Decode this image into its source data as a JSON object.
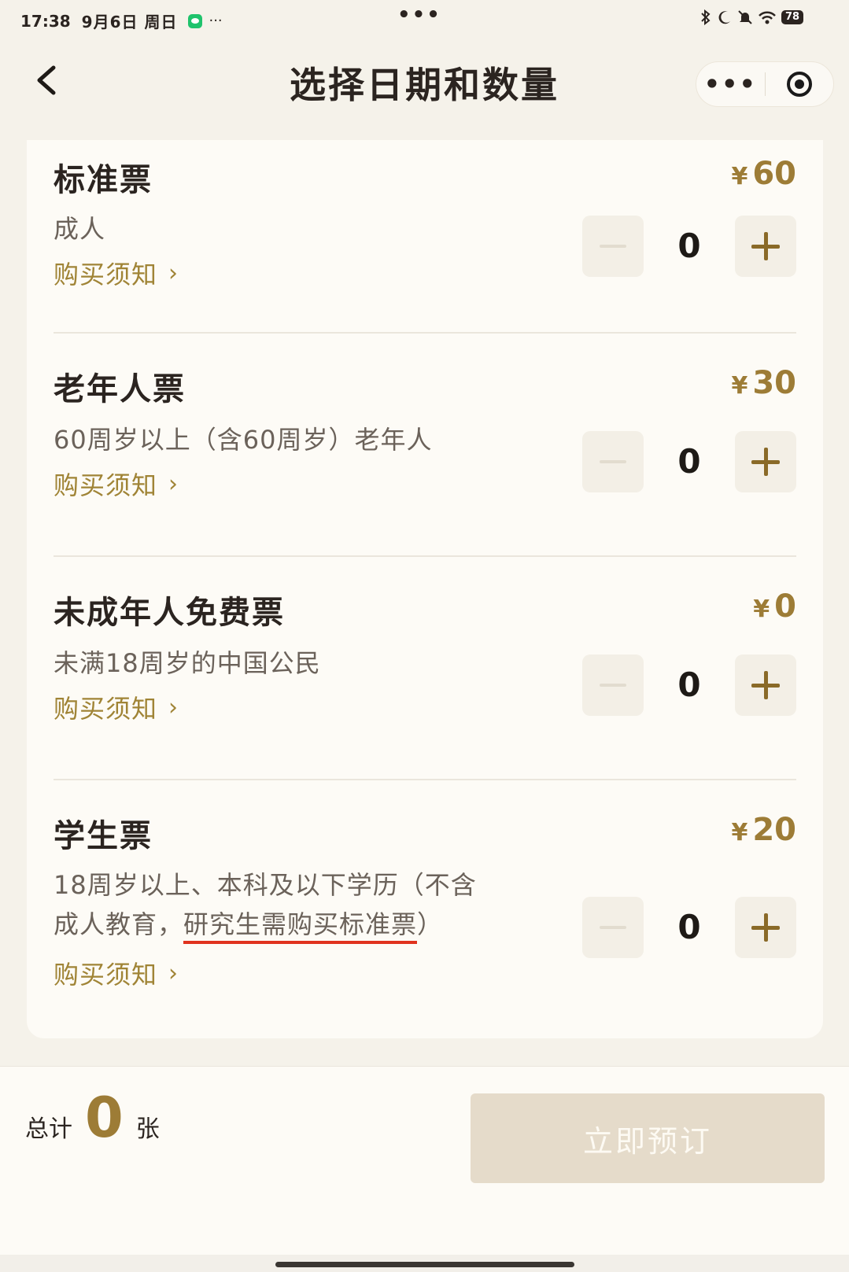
{
  "status_bar": {
    "time": "17:38",
    "date": "9月6日 周日",
    "more": "···",
    "center_dots": "•••",
    "battery": "78",
    "icons": [
      "bluetooth-icon",
      "moon-icon",
      "bell-off-icon",
      "wifi-icon",
      "battery-icon"
    ]
  },
  "navbar": {
    "title": "选择日期和数量",
    "back_icon": "chevron-left-icon",
    "more": "•••",
    "close_icon": "target-icon"
  },
  "tickets": [
    {
      "name": "标准票",
      "currency": "¥",
      "price": "60",
      "desc_lines": [
        "成人"
      ],
      "notice": "购买须知",
      "count": "0"
    },
    {
      "name": "老年人票",
      "currency": "¥",
      "price": "30",
      "desc_lines": [
        "60周岁以上（含60周岁）老年人"
      ],
      "notice": "购买须知",
      "count": "0"
    },
    {
      "name": "未成年人免费票",
      "currency": "¥",
      "price": "0",
      "desc_lines": [
        "未满18周岁的中国公民"
      ],
      "notice": "购买须知",
      "count": "0"
    },
    {
      "name": "学生票",
      "currency": "¥",
      "price": "20",
      "desc_line1": "18周岁以上、本科及以下学历（不含",
      "desc_line2_prefix": "成人教育，",
      "desc_line2_highlight": "研究生需购买标准票",
      "desc_line2_suffix": "）",
      "notice": "购买须知",
      "count": "0"
    }
  ],
  "chevron": "›",
  "footer": {
    "total_label": "总计",
    "total_count": "0",
    "total_unit": "张",
    "book_label": "立即预订"
  },
  "colors": {
    "accent_gold": "#9d7c36",
    "underline_red": "#e0321e",
    "disabled_button": "#e5dbca"
  }
}
